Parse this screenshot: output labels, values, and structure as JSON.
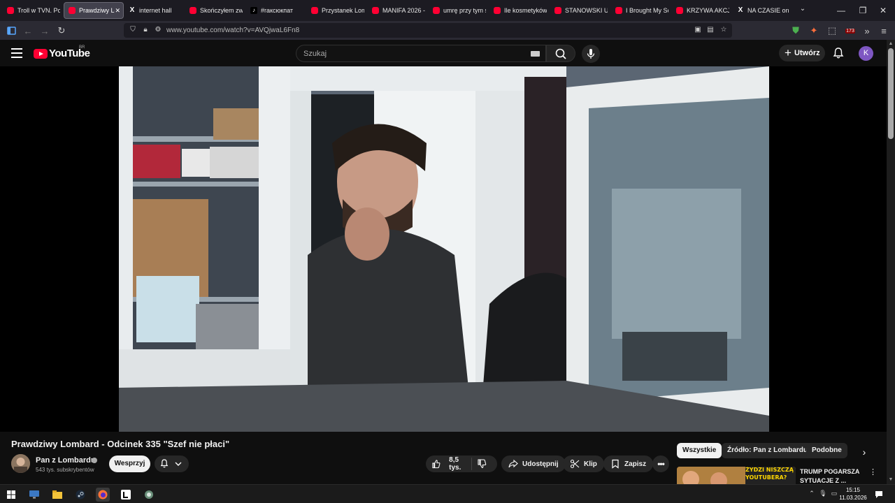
{
  "browser": {
    "tabs": [
      {
        "title": "Troll w TVN. Poc",
        "favicon": "youtube-icon",
        "active": false
      },
      {
        "title": "Prawdziwy Lo",
        "favicon": "youtube-icon",
        "active": true
      },
      {
        "title": "internet hall",
        "favicon": "x-icon",
        "active": false
      },
      {
        "title": "Skończyłem zwią",
        "favicon": "youtube-icon",
        "active": false
      },
      {
        "title": "#raксюкпат",
        "favicon": "tiktok-icon",
        "active": false
      },
      {
        "title": "Przystanek Lomb",
        "favicon": "youtube-icon",
        "active": false
      },
      {
        "title": "MANIFA 2026 -",
        "favicon": "youtube-icon",
        "active": false
      },
      {
        "title": "umrę przy tym s",
        "favicon": "youtube-icon",
        "active": false
      },
      {
        "title": "Ile kosmetyków",
        "favicon": "youtube-icon",
        "active": false
      },
      {
        "title": "STANOWSKI UJA",
        "favicon": "youtube-icon",
        "active": false
      },
      {
        "title": "I Brought My Se",
        "favicon": "youtube-icon",
        "active": false
      },
      {
        "title": "KRZYWA AKCJA",
        "favicon": "youtube-icon",
        "active": false
      },
      {
        "title": "NA CZASIE on X",
        "favicon": "x-icon",
        "active": false
      }
    ],
    "url": "www.youtube.com/watch?v=AVQjwaL6Fn8",
    "extension_badge": "173"
  },
  "youtube": {
    "logo_text": "YouTube",
    "country_code": "BR",
    "search_placeholder": "Szukaj",
    "create_label": "Utwórz",
    "avatar_letter": "K",
    "accent_color": "#ff0033"
  },
  "video": {
    "title": "Prawdziwy Lombard - Odcinek 335 \"Szef nie płaci\"",
    "channel_name": "Pan z Lombardu",
    "subscribers": "543 tys. subskrybentów",
    "support_label": "Wesprzyj",
    "likes": "8,5 tys.",
    "share_label": "Udostępnij",
    "clip_label": "Klip",
    "save_label": "Zapisz"
  },
  "sidebar": {
    "chips": [
      {
        "label": "Wszystkie",
        "active": true
      },
      {
        "label": "Źródło: Pan z Lombardu",
        "active": false
      },
      {
        "label": "Podobne",
        "active": false
      }
    ],
    "recommendation": {
      "title": "TRUMP POGARSZA SYTUACJE Z ...",
      "thumb_text_1": "ŻYDZI NISZCZĄ",
      "thumb_text_2": "YOUTUBERA?"
    }
  },
  "taskbar": {
    "time": "15:15",
    "date": "11.03.2026"
  }
}
